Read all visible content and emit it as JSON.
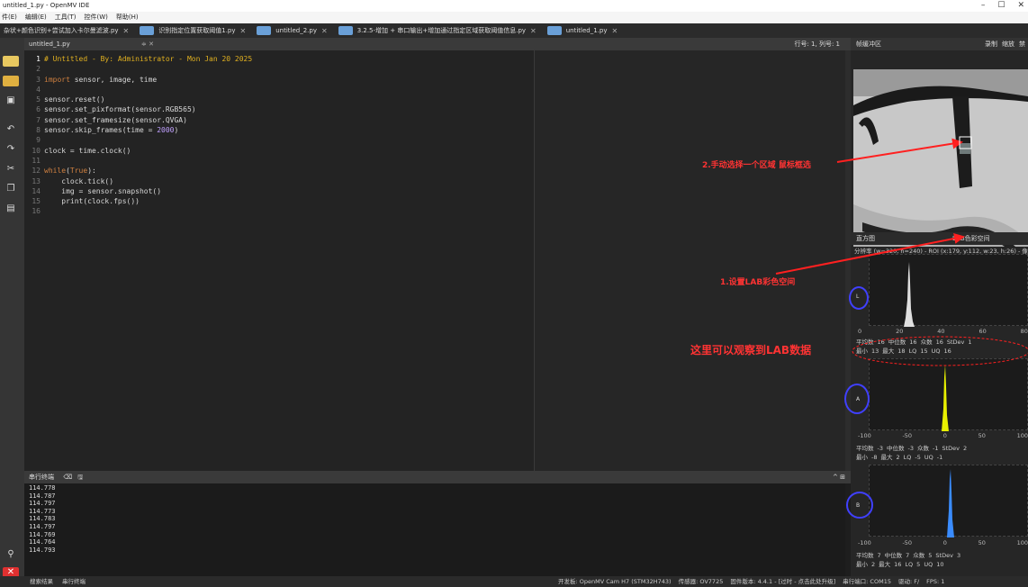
{
  "window": {
    "title": "untitled_1.py - OpenMV IDE",
    "controls": [
      "–",
      "☐",
      "✕"
    ]
  },
  "menu": [
    "件(E)",
    "编辑(E)",
    "工具(T)",
    "控件(W)",
    "帮助(H)"
  ],
  "file_tabs": [
    {
      "label": "杂状+颜色识别+尝试加入卡尔曼滤波.py"
    },
    {
      "label": "识别指定位置获取阈值1.py"
    },
    {
      "label": "untitled_2.py"
    },
    {
      "label": "3.2.5-增加 + 串口输出+增加通过指定区域获取阈值信息.py"
    },
    {
      "label": "untitled_1.py"
    }
  ],
  "editor": {
    "filename": "untitled_1.py",
    "controls": "≑ ✕",
    "position": "行号: 1, 列号: 1",
    "current_line": 1,
    "lines": [
      {
        "n": "1",
        "segs": [
          {
            "c": "cmt",
            "t": "# Untitled - By: Administrator - Mon Jan 20 2025"
          }
        ]
      },
      {
        "n": "2",
        "segs": []
      },
      {
        "n": "3",
        "segs": [
          {
            "c": "kw",
            "t": "import"
          },
          {
            "c": "plain",
            "t": " sensor, image, time"
          }
        ]
      },
      {
        "n": "4",
        "segs": []
      },
      {
        "n": "5",
        "segs": [
          {
            "c": "plain",
            "t": "sensor.reset()"
          }
        ]
      },
      {
        "n": "6",
        "segs": [
          {
            "c": "plain",
            "t": "sensor.set_pixformat(sensor.RGB565)"
          }
        ]
      },
      {
        "n": "7",
        "segs": [
          {
            "c": "plain",
            "t": "sensor.set_framesize(sensor.QVGA)"
          }
        ]
      },
      {
        "n": "8",
        "segs": [
          {
            "c": "plain",
            "t": "sensor.skip_frames(time = "
          },
          {
            "c": "num",
            "t": "2000"
          },
          {
            "c": "plain",
            "t": ")"
          }
        ]
      },
      {
        "n": "9",
        "segs": []
      },
      {
        "n": "10",
        "segs": [
          {
            "c": "plain",
            "t": "clock = time.clock()"
          }
        ]
      },
      {
        "n": "11",
        "segs": []
      },
      {
        "n": "12",
        "segs": [
          {
            "c": "kw",
            "t": "while"
          },
          {
            "c": "plain",
            "t": "("
          },
          {
            "c": "kw",
            "t": "True"
          },
          {
            "c": "plain",
            "t": "):"
          }
        ]
      },
      {
        "n": "13",
        "segs": [
          {
            "c": "plain",
            "t": "    clock.tick()"
          }
        ]
      },
      {
        "n": "14",
        "segs": [
          {
            "c": "plain",
            "t": "    img = sensor.snapshot()"
          }
        ]
      },
      {
        "n": "15",
        "segs": [
          {
            "c": "plain",
            "t": "    print(clock.fps())"
          }
        ]
      },
      {
        "n": "16",
        "segs": []
      }
    ]
  },
  "serial": {
    "title": "串行终端",
    "values": [
      "114.778",
      "114.787",
      "114.797",
      "114.773",
      "114.783",
      "114.797",
      "114.769",
      "114.764",
      "114.793"
    ]
  },
  "framebuffer": {
    "title": "帧缓冲区",
    "buttons": [
      "录制",
      "缩放",
      "禁"
    ]
  },
  "histogram": {
    "title": "直方图",
    "colorspace": "LAB色彩空间",
    "subtitle": "分辨率 (w=320, h=240) - ROI (x:179, y:112, w:23, h:26) - 像",
    "channels": [
      {
        "name": "L",
        "axis": [
          "0",
          "20",
          "40",
          "60",
          "80"
        ],
        "color": "#e0e0e0",
        "stats": [
          [
            "平均数",
            "16",
            "中位数",
            "16",
            "众数",
            "16",
            "StDev",
            "1"
          ],
          [
            "最小",
            "13",
            "最大",
            "18",
            "LQ",
            "15",
            "UQ",
            "16"
          ]
        ]
      },
      {
        "name": "A",
        "axis": [
          "-100",
          "-50",
          "0",
          "50",
          "100"
        ],
        "color": "#e8f000",
        "stats": [
          [
            "平均数",
            "-3",
            "中位数",
            "-3",
            "众数",
            "-1",
            "StDev",
            "2"
          ],
          [
            "最小",
            "-8",
            "最大",
            "2",
            "LQ",
            "-5",
            "UQ",
            "-1"
          ]
        ]
      },
      {
        "name": "B",
        "axis": [
          "-100",
          "-50",
          "0",
          "50",
          "100"
        ],
        "color": "#3a8cff",
        "stats": [
          [
            "平均数",
            "7",
            "中位数",
            "7",
            "众数",
            "5",
            "StDev",
            "3"
          ],
          [
            "最小",
            "2",
            "最大",
            "16",
            "LQ",
            "5",
            "UQ",
            "10"
          ]
        ]
      }
    ]
  },
  "annotations": {
    "step2": "2.手动选择一个区域 鼠标框选",
    "step1": "1.设置LAB彩色空间",
    "observe": "这里可以观察到LAB数据"
  },
  "statusbar": {
    "left_tabs": [
      "搜索结果",
      "串行终端"
    ],
    "board": "开发板: OpenMV Cam H7 (STM32H743)",
    "sensor": "传感器: OV7725",
    "firmware": "固件版本: 4.4.1 - [过时 - 点击此处升级]",
    "port": "串行端口: COM15",
    "drive": "驱动: F/",
    "fps": "FPS: 1"
  }
}
